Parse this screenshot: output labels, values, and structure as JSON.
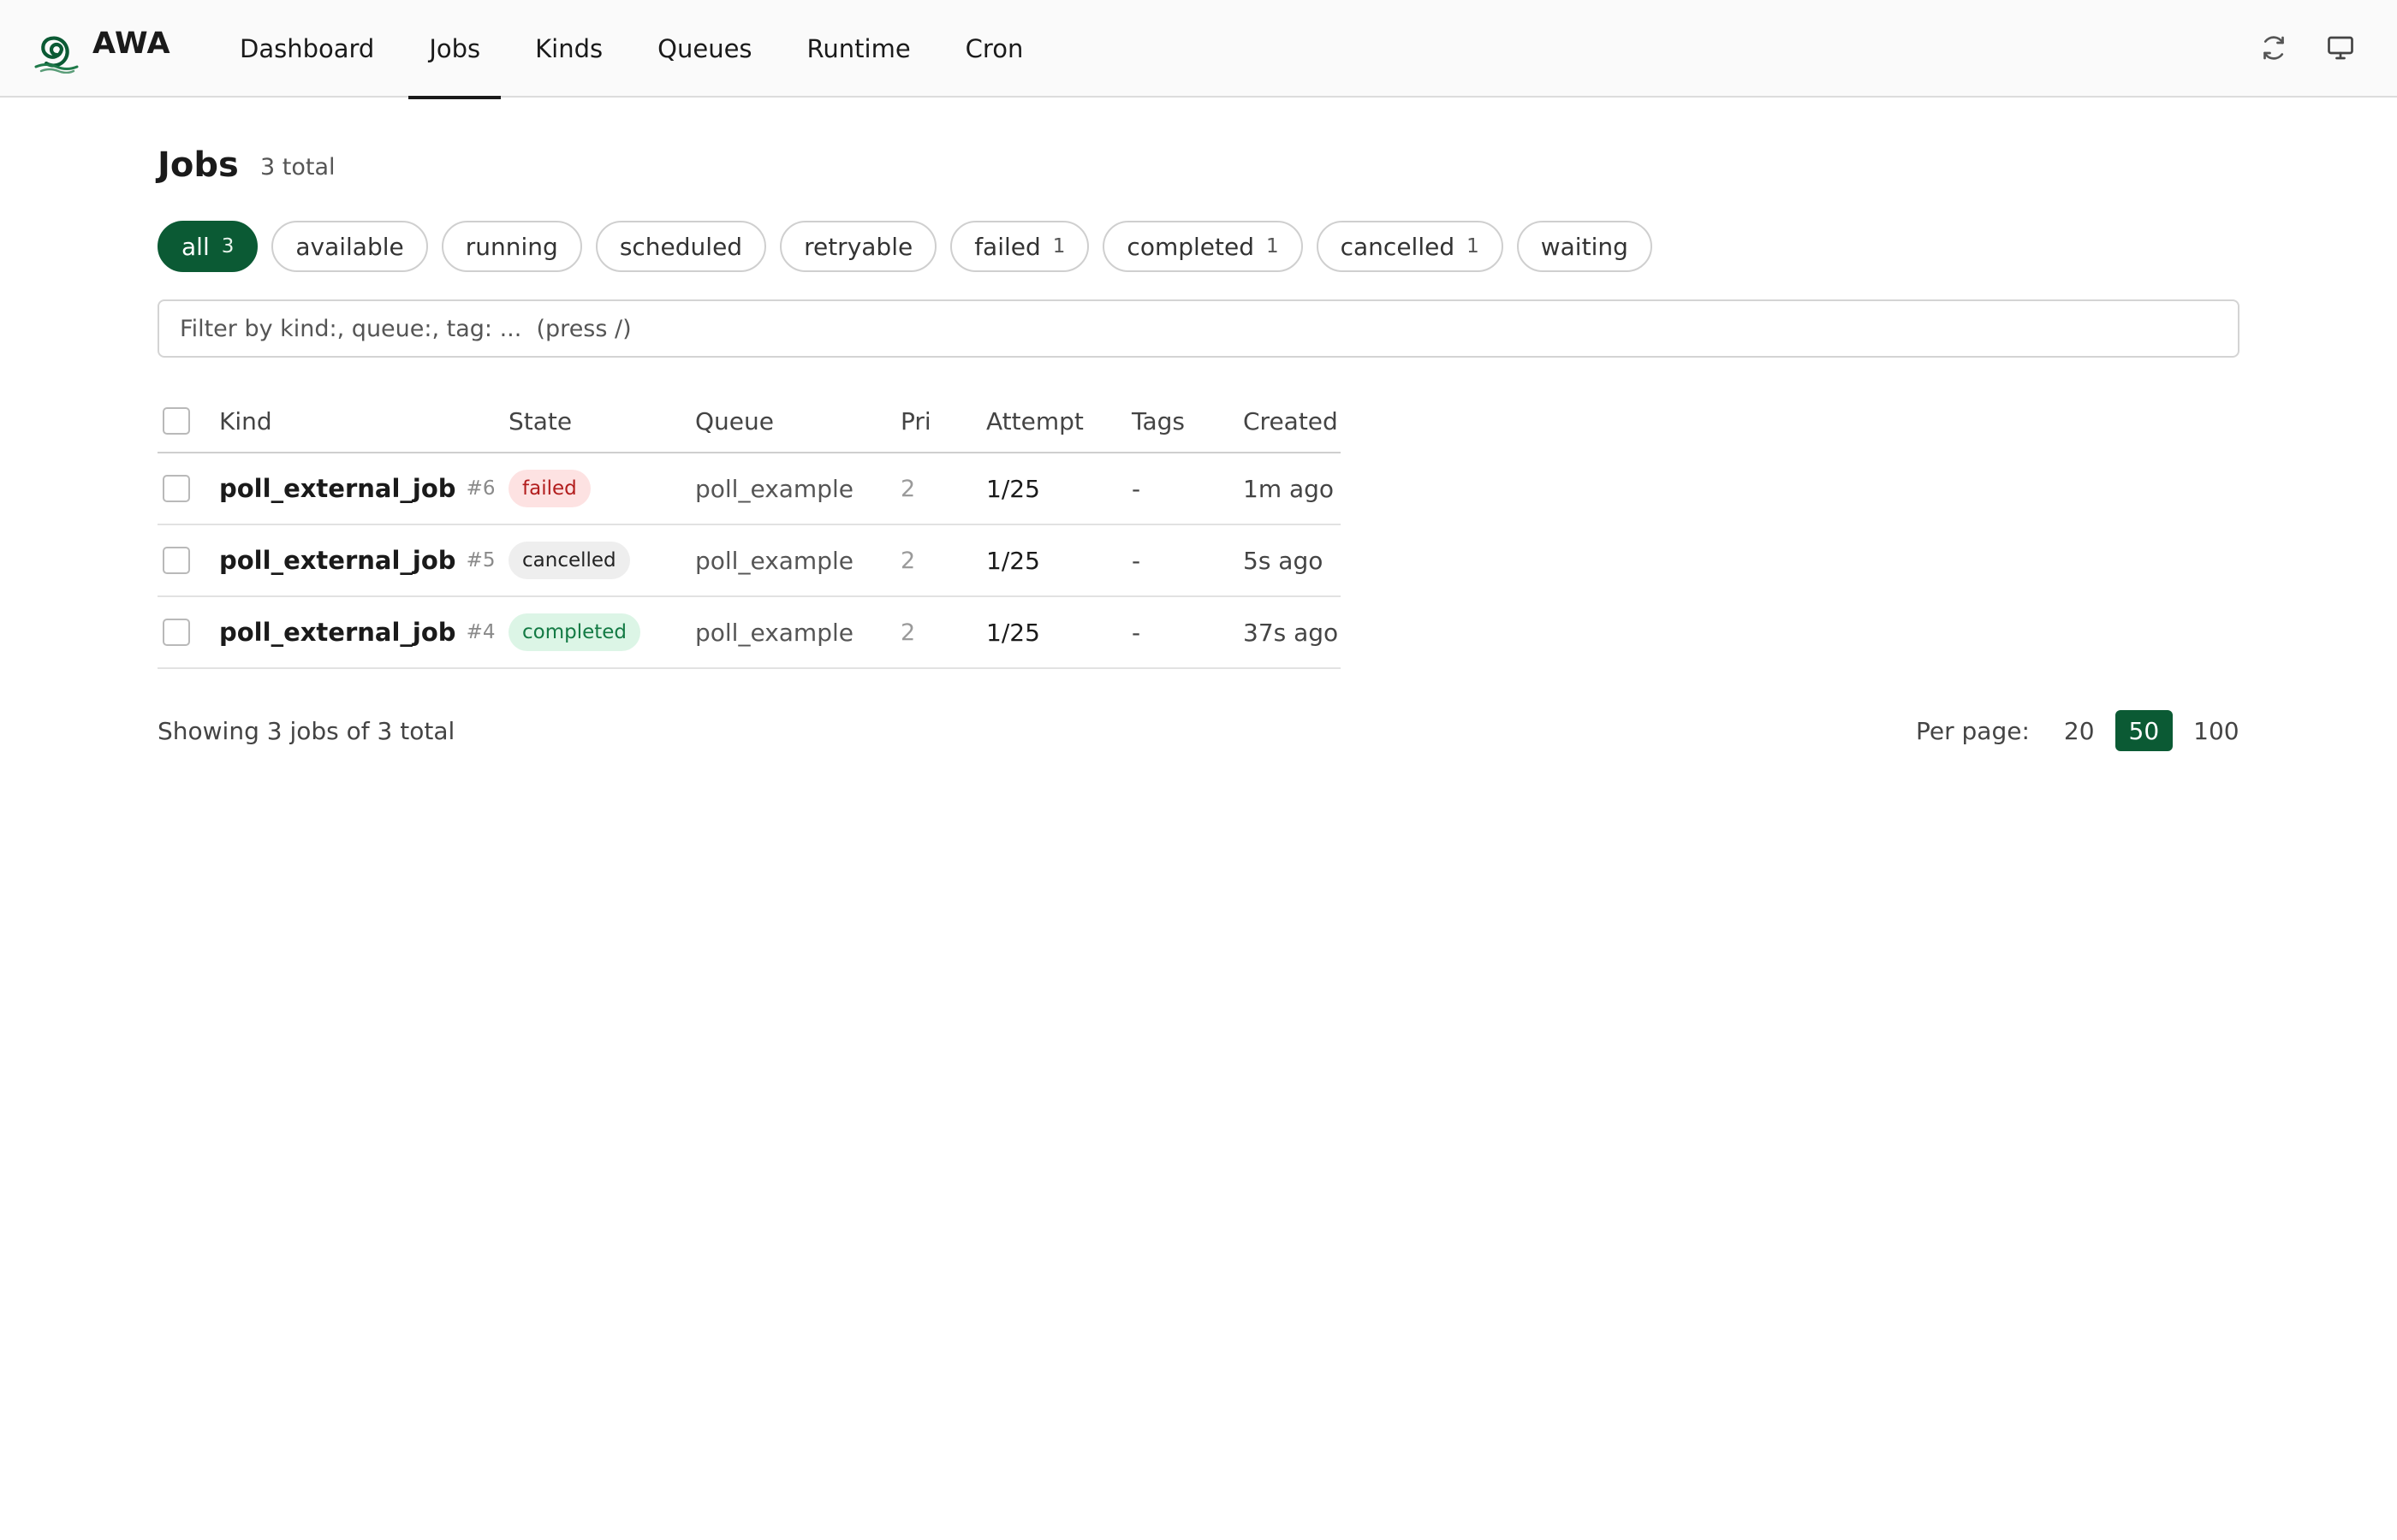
{
  "app": {
    "name": "AWA"
  },
  "nav": {
    "items": [
      {
        "label": "Dashboard"
      },
      {
        "label": "Jobs",
        "active": true
      },
      {
        "label": "Kinds"
      },
      {
        "label": "Queues"
      },
      {
        "label": "Runtime"
      },
      {
        "label": "Cron"
      }
    ],
    "icons": [
      "refresh-icon",
      "monitor-icon"
    ]
  },
  "page": {
    "title": "Jobs",
    "total": "3 total"
  },
  "filters": [
    {
      "label": "all",
      "count": "3",
      "active": true
    },
    {
      "label": "available",
      "count": ""
    },
    {
      "label": "running",
      "count": ""
    },
    {
      "label": "scheduled",
      "count": ""
    },
    {
      "label": "retryable",
      "count": ""
    },
    {
      "label": "failed",
      "count": "1"
    },
    {
      "label": "completed",
      "count": "1"
    },
    {
      "label": "cancelled",
      "count": "1"
    },
    {
      "label": "waiting",
      "count": ""
    }
  ],
  "search": {
    "placeholder": "Filter by kind:, queue:, tag: ...  (press /)",
    "value": ""
  },
  "table": {
    "columns": {
      "kind": "Kind",
      "state": "State",
      "queue": "Queue",
      "pri": "Pri",
      "attempt": "Attempt",
      "tags": "Tags",
      "created": "Created"
    },
    "rows": [
      {
        "kind": "poll_external_job",
        "id": "#6",
        "state": "failed",
        "queue": "poll_example",
        "pri": "2",
        "attempt": "1/25",
        "tags": "-",
        "created": "1m ago"
      },
      {
        "kind": "poll_external_job",
        "id": "#5",
        "state": "cancelled",
        "queue": "poll_example",
        "pri": "2",
        "attempt": "1/25",
        "tags": "-",
        "created": "5s ago"
      },
      {
        "kind": "poll_external_job",
        "id": "#4",
        "state": "completed",
        "queue": "poll_example",
        "pri": "2",
        "attempt": "1/25",
        "tags": "-",
        "created": "37s ago"
      }
    ]
  },
  "footer": {
    "showing": "Showing 3 jobs of 3 total",
    "per_page_label": "Per page:",
    "per_page_options": [
      "20",
      "50",
      "100"
    ],
    "per_page_selected": "50"
  },
  "colors": {
    "accent": "#0b5a34",
    "failed_bg": "#fde2e2",
    "failed_fg": "#b21d1d",
    "cancelled_bg": "#eeeeee",
    "completed_bg": "#dcf5e6",
    "completed_fg": "#137a44"
  }
}
